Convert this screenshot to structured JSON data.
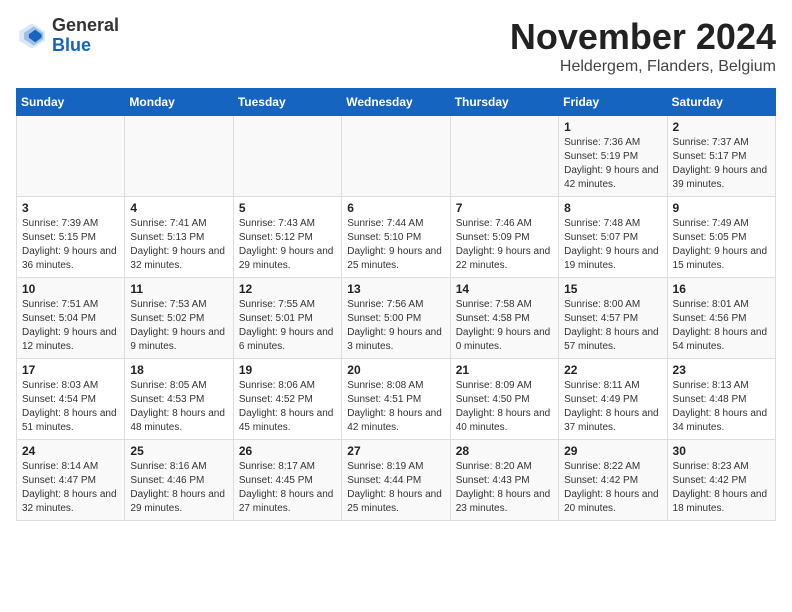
{
  "logo": {
    "general": "General",
    "blue": "Blue"
  },
  "title": "November 2024",
  "location": "Heldergem, Flanders, Belgium",
  "days_of_week": [
    "Sunday",
    "Monday",
    "Tuesday",
    "Wednesday",
    "Thursday",
    "Friday",
    "Saturday"
  ],
  "weeks": [
    [
      {
        "day": "",
        "info": ""
      },
      {
        "day": "",
        "info": ""
      },
      {
        "day": "",
        "info": ""
      },
      {
        "day": "",
        "info": ""
      },
      {
        "day": "",
        "info": ""
      },
      {
        "day": "1",
        "info": "Sunrise: 7:36 AM\nSunset: 5:19 PM\nDaylight: 9 hours and 42 minutes."
      },
      {
        "day": "2",
        "info": "Sunrise: 7:37 AM\nSunset: 5:17 PM\nDaylight: 9 hours and 39 minutes."
      }
    ],
    [
      {
        "day": "3",
        "info": "Sunrise: 7:39 AM\nSunset: 5:15 PM\nDaylight: 9 hours and 36 minutes."
      },
      {
        "day": "4",
        "info": "Sunrise: 7:41 AM\nSunset: 5:13 PM\nDaylight: 9 hours and 32 minutes."
      },
      {
        "day": "5",
        "info": "Sunrise: 7:43 AM\nSunset: 5:12 PM\nDaylight: 9 hours and 29 minutes."
      },
      {
        "day": "6",
        "info": "Sunrise: 7:44 AM\nSunset: 5:10 PM\nDaylight: 9 hours and 25 minutes."
      },
      {
        "day": "7",
        "info": "Sunrise: 7:46 AM\nSunset: 5:09 PM\nDaylight: 9 hours and 22 minutes."
      },
      {
        "day": "8",
        "info": "Sunrise: 7:48 AM\nSunset: 5:07 PM\nDaylight: 9 hours and 19 minutes."
      },
      {
        "day": "9",
        "info": "Sunrise: 7:49 AM\nSunset: 5:05 PM\nDaylight: 9 hours and 15 minutes."
      }
    ],
    [
      {
        "day": "10",
        "info": "Sunrise: 7:51 AM\nSunset: 5:04 PM\nDaylight: 9 hours and 12 minutes."
      },
      {
        "day": "11",
        "info": "Sunrise: 7:53 AM\nSunset: 5:02 PM\nDaylight: 9 hours and 9 minutes."
      },
      {
        "day": "12",
        "info": "Sunrise: 7:55 AM\nSunset: 5:01 PM\nDaylight: 9 hours and 6 minutes."
      },
      {
        "day": "13",
        "info": "Sunrise: 7:56 AM\nSunset: 5:00 PM\nDaylight: 9 hours and 3 minutes."
      },
      {
        "day": "14",
        "info": "Sunrise: 7:58 AM\nSunset: 4:58 PM\nDaylight: 9 hours and 0 minutes."
      },
      {
        "day": "15",
        "info": "Sunrise: 8:00 AM\nSunset: 4:57 PM\nDaylight: 8 hours and 57 minutes."
      },
      {
        "day": "16",
        "info": "Sunrise: 8:01 AM\nSunset: 4:56 PM\nDaylight: 8 hours and 54 minutes."
      }
    ],
    [
      {
        "day": "17",
        "info": "Sunrise: 8:03 AM\nSunset: 4:54 PM\nDaylight: 8 hours and 51 minutes."
      },
      {
        "day": "18",
        "info": "Sunrise: 8:05 AM\nSunset: 4:53 PM\nDaylight: 8 hours and 48 minutes."
      },
      {
        "day": "19",
        "info": "Sunrise: 8:06 AM\nSunset: 4:52 PM\nDaylight: 8 hours and 45 minutes."
      },
      {
        "day": "20",
        "info": "Sunrise: 8:08 AM\nSunset: 4:51 PM\nDaylight: 8 hours and 42 minutes."
      },
      {
        "day": "21",
        "info": "Sunrise: 8:09 AM\nSunset: 4:50 PM\nDaylight: 8 hours and 40 minutes."
      },
      {
        "day": "22",
        "info": "Sunrise: 8:11 AM\nSunset: 4:49 PM\nDaylight: 8 hours and 37 minutes."
      },
      {
        "day": "23",
        "info": "Sunrise: 8:13 AM\nSunset: 4:48 PM\nDaylight: 8 hours and 34 minutes."
      }
    ],
    [
      {
        "day": "24",
        "info": "Sunrise: 8:14 AM\nSunset: 4:47 PM\nDaylight: 8 hours and 32 minutes."
      },
      {
        "day": "25",
        "info": "Sunrise: 8:16 AM\nSunset: 4:46 PM\nDaylight: 8 hours and 29 minutes."
      },
      {
        "day": "26",
        "info": "Sunrise: 8:17 AM\nSunset: 4:45 PM\nDaylight: 8 hours and 27 minutes."
      },
      {
        "day": "27",
        "info": "Sunrise: 8:19 AM\nSunset: 4:44 PM\nDaylight: 8 hours and 25 minutes."
      },
      {
        "day": "28",
        "info": "Sunrise: 8:20 AM\nSunset: 4:43 PM\nDaylight: 8 hours and 23 minutes."
      },
      {
        "day": "29",
        "info": "Sunrise: 8:22 AM\nSunset: 4:42 PM\nDaylight: 8 hours and 20 minutes."
      },
      {
        "day": "30",
        "info": "Sunrise: 8:23 AM\nSunset: 4:42 PM\nDaylight: 8 hours and 18 minutes."
      }
    ]
  ]
}
